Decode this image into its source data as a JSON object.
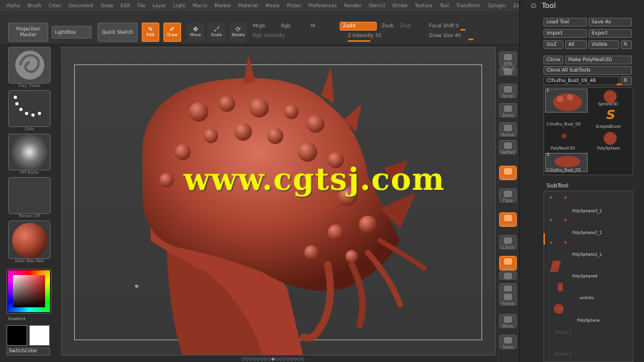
{
  "menu": [
    "Alpha",
    "Brush",
    "Color",
    "Document",
    "Draw",
    "Edit",
    "File",
    "Layer",
    "Light",
    "Macro",
    "Marker",
    "Material",
    "Movie",
    "Picker",
    "Preferences",
    "Render",
    "Stencil",
    "Stroke",
    "Texture",
    "Tool",
    "Transform",
    "Zplugin",
    "Zscript"
  ],
  "toolbar": {
    "projection_master": "Projection Master",
    "lightbox": "LightBox",
    "quick_sketch": "Quick Sketch",
    "edit": "Edit",
    "draw": "Draw",
    "move": "Move",
    "scale": "Scale",
    "rotate": "Rotate",
    "mrgb": "Mrgb",
    "rgb": "Rgb",
    "m": "M",
    "rgb_intensity": "Rgb Intensity",
    "zadd": "Zadd",
    "zsub": "Zsub",
    "zcut": "Zcut",
    "z_intensity": "Z Intensity 33",
    "focal_shift": "Focal Shift 0",
    "draw_size": "Draw Size 40"
  },
  "left_shelf": {
    "brush_caption": "Clay_Tubes",
    "stroke_caption": "Dots",
    "alpha_caption": "Off Alpha",
    "texture_caption": "Texture Off",
    "material_caption": "Reds Wax Red",
    "gradient": "Gradient",
    "switch_color": "SwitchColor"
  },
  "right_shelf": [
    "BPR",
    "SPix 3",
    "Scroll",
    "Zoom",
    "Actual",
    "AAHalf",
    "Persp",
    "Floor",
    "Local",
    "L.Sym",
    "Xyz",
    "",
    "",
    "Frame",
    "Move",
    "Scale"
  ],
  "tool_panel": {
    "title": "Tool",
    "load_tool": "Load Tool",
    "save_as": "Save As",
    "import": "Import",
    "export": "Export",
    "goz": "GoZ",
    "all": "All",
    "visible": "Visible",
    "r": "R",
    "clone": "Clone",
    "make_polymesh": "Make PolyMesh3D",
    "clone_all": "Clone All SubTools",
    "current_tool": "Cthulhu_Bust_09_48",
    "current_r": "R",
    "count1": "1",
    "count3": "3",
    "tools": [
      {
        "name": "Cthulhu_Bust_09",
        "icon": "bust-icon"
      },
      {
        "name": "Sphere3D",
        "icon": "sphere-icon"
      },
      {
        "name": "SimpleBrush",
        "icon": "s-brush-icon"
      },
      {
        "name": "PolyMesh3D",
        "icon": "star-icon"
      },
      {
        "name": "PolySphere",
        "icon": "sphere-icon"
      },
      {
        "name": "Cthulhu_Bust_09",
        "icon": "bust-icon"
      }
    ],
    "subtool_header": "SubTool",
    "subtools": [
      "PolySphere3_1",
      "PolySphere2_1",
      "PolySphere1_1",
      "PolySphere4",
      "unlinks",
      "PolySphere",
      "Attribs 1",
      "Attribs 2"
    ]
  },
  "watermark": "www.cgtsj.com",
  "scroll_dots": "◇◇◇◇◇◇◇◇◆◇◇◇◇◇◇◇◇"
}
